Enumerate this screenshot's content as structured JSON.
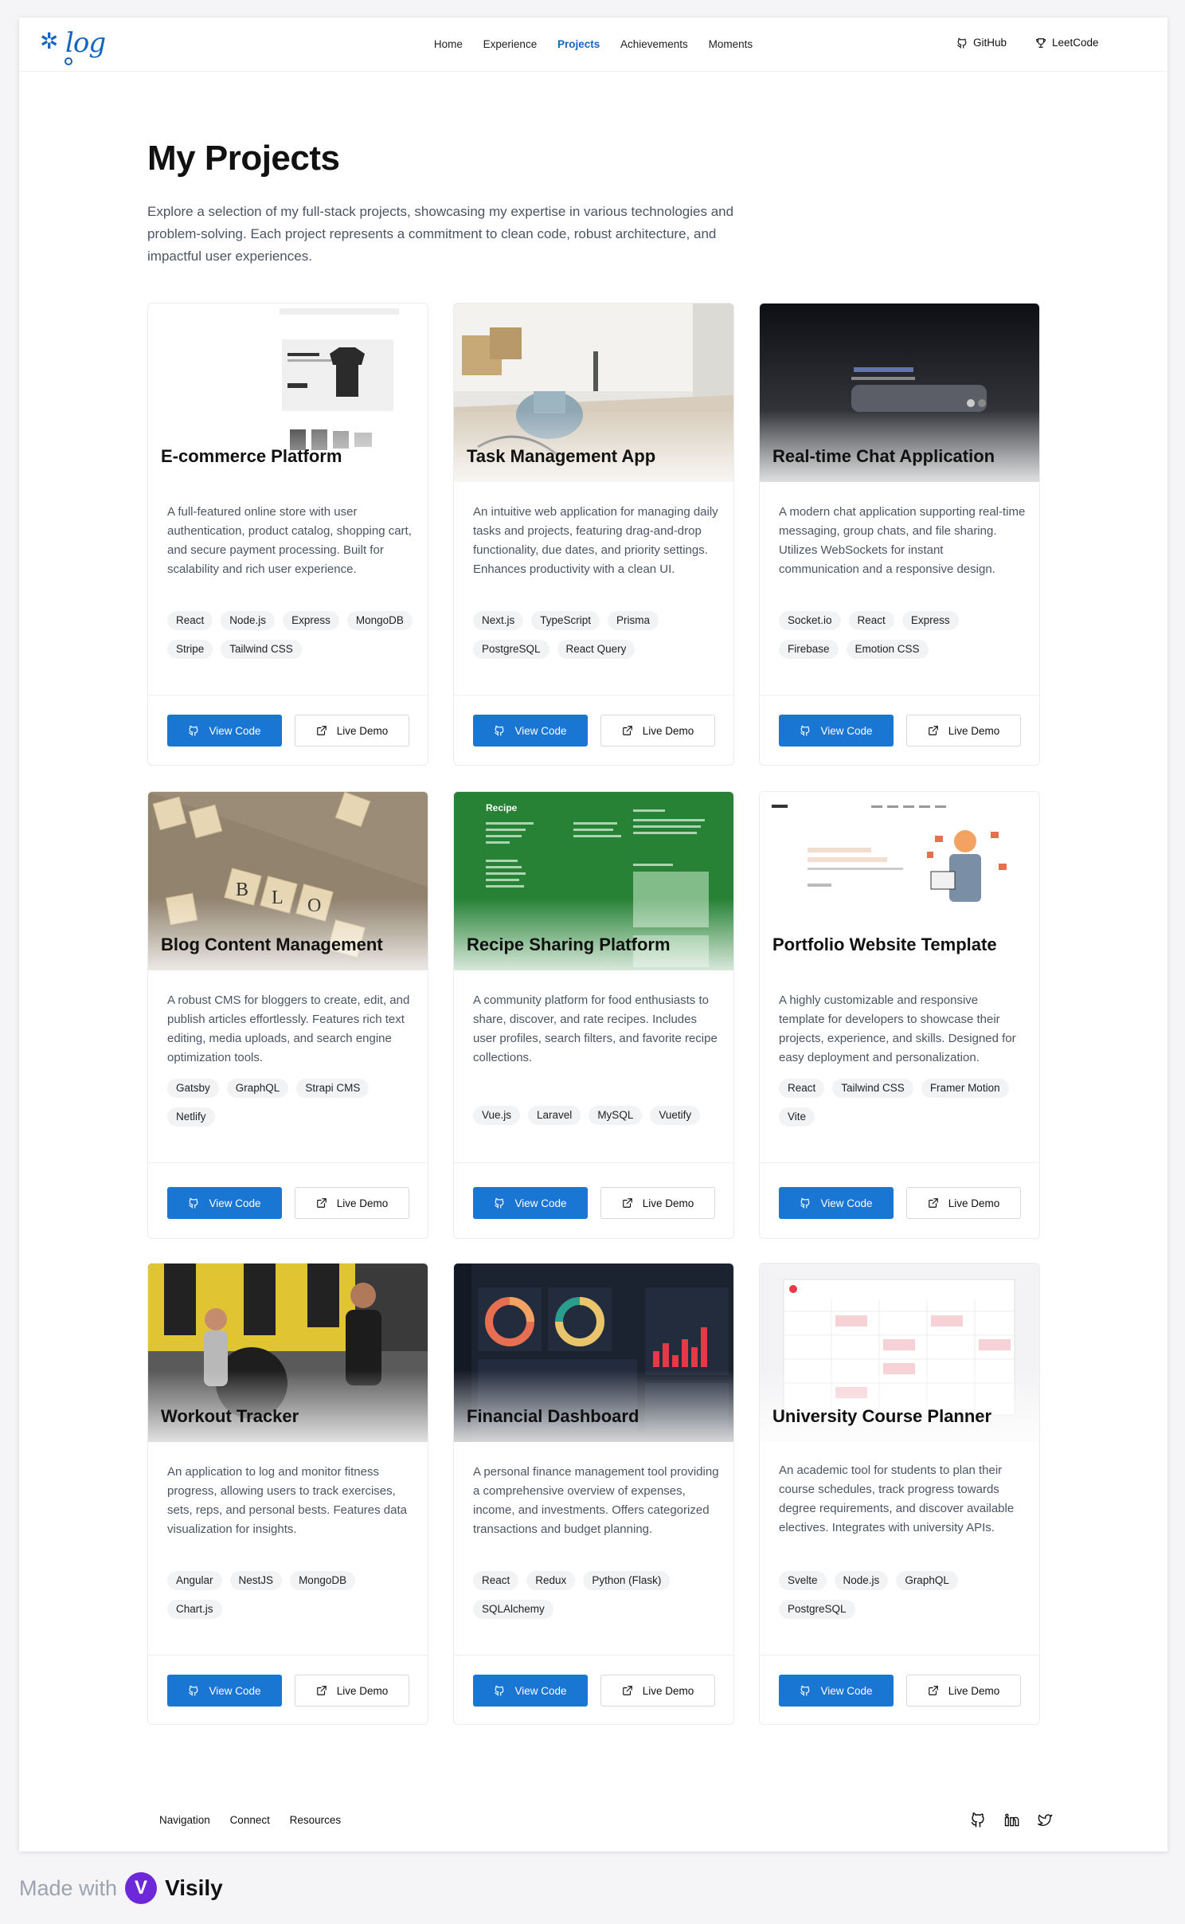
{
  "header": {
    "logo_text": "log",
    "nav": [
      "Home",
      "Experience",
      "Projects",
      "Achievements",
      "Moments"
    ],
    "active_nav": "Projects",
    "github_label": "GitHub",
    "leetcode_label": "LeetCode"
  },
  "hero": {
    "title": "My Projects",
    "lead": "Explore a selection of my full-stack projects, showcasing my expertise in various technologies and problem-solving. Each project represents a commitment to clean code, robust architecture, and impactful user experiences."
  },
  "buttons": {
    "view_code": "View Code",
    "live_demo": "Live Demo"
  },
  "projects": [
    {
      "title": "E-commerce Platform",
      "description": "A full-featured online store with user authentication, product catalog, shopping cart, and secure payment processing. Built for scalability and rich user experience.",
      "tags": [
        "React",
        "Node.js",
        "Express",
        "MongoDB",
        "Stripe",
        "Tailwind CSS"
      ],
      "image": "shop-product-screenshot"
    },
    {
      "title": "Task Management App",
      "description": "An intuitive web application for managing daily tasks and projects, featuring drag-and-drop functionality, due dates, and priority settings. Enhances productivity with a clean UI.",
      "tags": [
        "Next.js",
        "TypeScript",
        "Prisma",
        "PostgreSQL",
        "React Query"
      ],
      "image": "vacuum-cleaner-room-photo"
    },
    {
      "title": "Real-time Chat Application",
      "description": "A modern chat application supporting real-time messaging, group chats, and file sharing. Utilizes WebSockets for instant communication and a responsive design.",
      "tags": [
        "Socket.io",
        "React",
        "Express",
        "Firebase",
        "Emotion CSS"
      ],
      "image": "dark-chat-screenshot"
    },
    {
      "title": "Blog Content Management",
      "description": "A robust CMS for bloggers to create, edit, and publish articles effortlessly. Features rich text editing, media uploads, and search engine optimization tools.",
      "tags": [
        "Gatsby",
        "GraphQL",
        "Strapi CMS",
        "Netlify"
      ],
      "image": "scrabble-tiles-blog-photo"
    },
    {
      "title": "Recipe Sharing Platform",
      "description": "A community platform for food enthusiasts to share, discover, and rate recipes. Includes user profiles, search filters, and favorite recipe collections.",
      "tags": [
        "Vue.js",
        "Laravel",
        "MySQL",
        "Vuetify"
      ],
      "image": "green-recipe-screenshot"
    },
    {
      "title": "Portfolio Website Template",
      "description": "A highly customizable and responsive template for developers to showcase their projects, experience, and skills. Designed for easy deployment and personalization.",
      "tags": [
        "React",
        "Tailwind CSS",
        "Framer Motion",
        "Vite"
      ],
      "image": "portfolio-illustration-screenshot"
    },
    {
      "title": "Workout Tracker",
      "description": "An application to log and monitor fitness progress, allowing users to track exercises, sets, reps, and personal bests. Features data visualization for insights.",
      "tags": [
        "Angular",
        "NestJS",
        "MongoDB",
        "Chart.js"
      ],
      "image": "gym-people-photo"
    },
    {
      "title": "Financial Dashboard",
      "description": "A personal finance management tool providing a comprehensive overview of expenses, income, and investments. Offers categorized transactions and budget planning.",
      "tags": [
        "React",
        "Redux",
        "Python (Flask)",
        "SQLAlchemy"
      ],
      "image": "dark-dashboard-screenshot"
    },
    {
      "title": "University Course Planner",
      "description": "An academic tool for students to plan their course schedules, track progress towards degree requirements, and discover available electives. Integrates with university APIs.",
      "tags": [
        "Svelte",
        "Node.js",
        "GraphQL",
        "PostgreSQL"
      ],
      "image": "calendar-schedule-screenshot"
    }
  ],
  "footer": {
    "links": [
      "Navigation",
      "Connect",
      "Resources"
    ],
    "icons": [
      "github-icon",
      "linkedin-icon",
      "twitter-icon"
    ]
  },
  "badge": {
    "prefix": "Made with",
    "brand": "Visily"
  },
  "colors": {
    "accent": "#1976d2",
    "text": "#111111",
    "muted": "#4b5563"
  }
}
